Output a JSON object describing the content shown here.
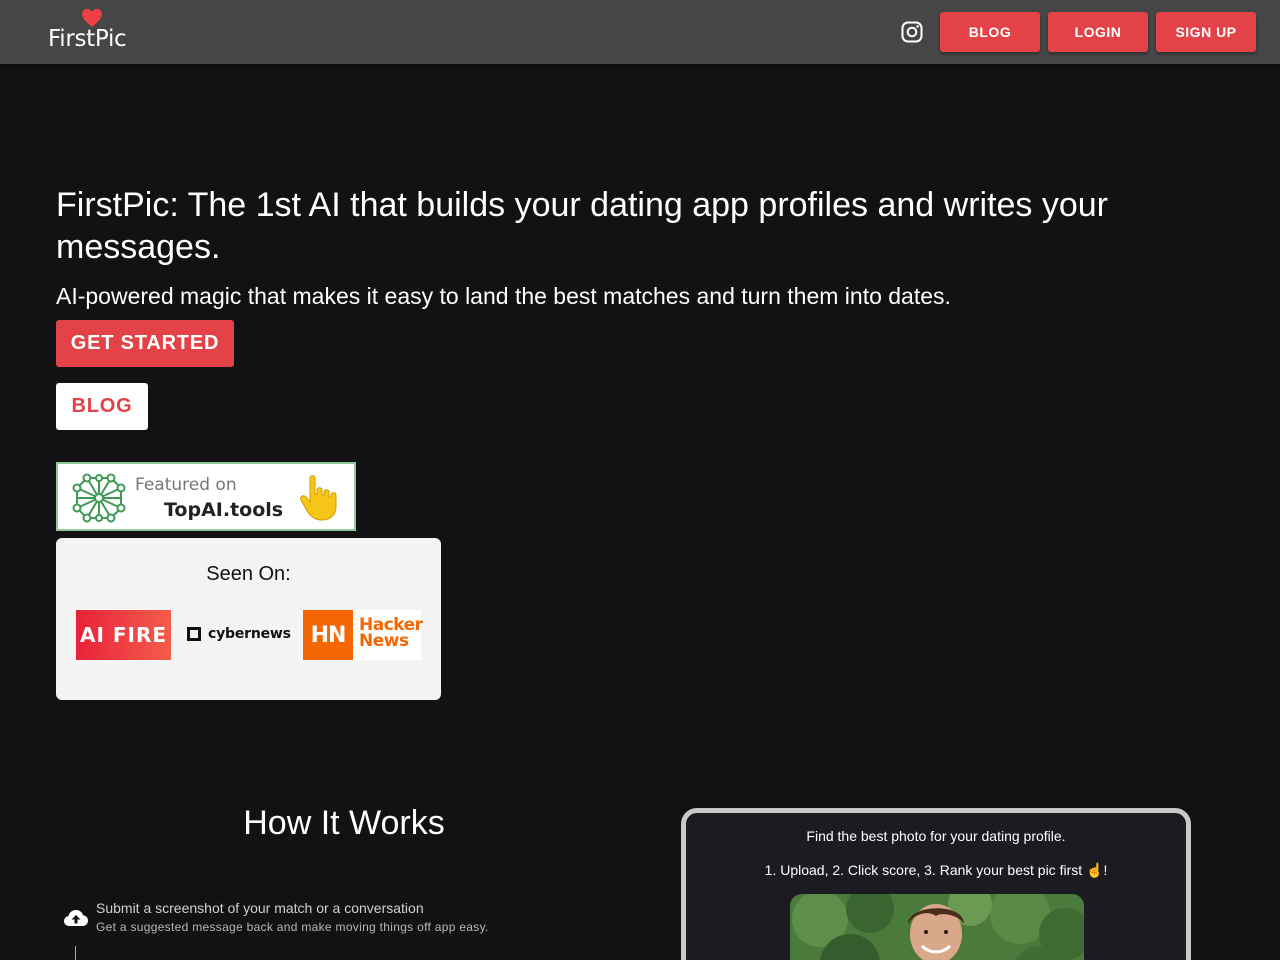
{
  "header": {
    "logo_text": "FirstPic",
    "nav": {
      "blog": "BLOG",
      "login": "LOGIN",
      "signup": "SIGN UP"
    }
  },
  "hero": {
    "title": "FirstPic: The 1st AI that builds your dating app profiles and writes your messages.",
    "subtitle": "AI-powered magic that makes it easy to land the best matches and turn them into dates.",
    "get_started": "GET STARTED",
    "blog": "BLOG"
  },
  "featured": {
    "featured_on": "Featured on",
    "site": "TopAI.tools"
  },
  "seen_on": {
    "title": "Seen On:",
    "ai_fire": "AI FIRE",
    "cybernews": "cybernews",
    "hn_mark": "HN",
    "hn_line1": "Hacker",
    "hn_line2": "News"
  },
  "how_it_works": {
    "title": "How It Works",
    "steps": [
      {
        "title": "Submit a screenshot of your match or a conversation",
        "description": "Get a suggested message back and make moving things off app easy."
      }
    ]
  },
  "phone_demo": {
    "line1": "Find the best photo for your dating profile.",
    "line2": "1. Upload, 2. Click score, 3. Rank your best pic first ☝️!"
  },
  "colors": {
    "accent": "#e34348",
    "header_bg": "#464646",
    "page_bg": "#121214"
  }
}
